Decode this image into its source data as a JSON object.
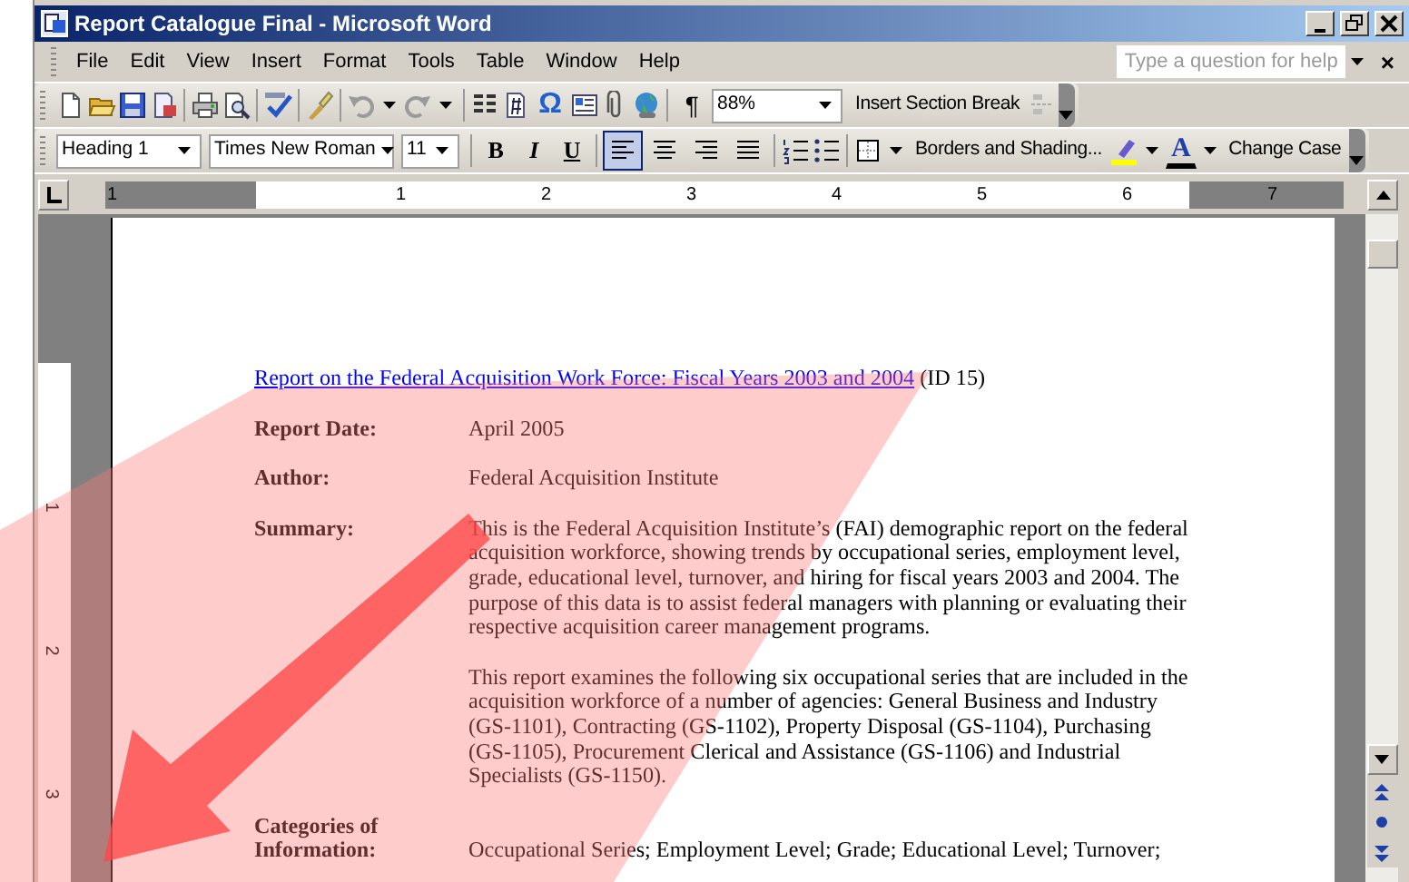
{
  "window": {
    "title": "Report Catalogue Final - Microsoft Word"
  },
  "menu": [
    "File",
    "Edit",
    "View",
    "Insert",
    "Format",
    "Tools",
    "Table",
    "Window",
    "Help"
  ],
  "help": {
    "placeholder": "Type a question for help",
    "close": "×"
  },
  "standard_toolbar": {
    "symbol": "Ω",
    "pilcrow": "¶",
    "zoom": "88%",
    "section_break": "Insert Section Break"
  },
  "formatting_toolbar": {
    "style": "Heading 1",
    "font": "Times New Roman",
    "size": "11",
    "bold": "B",
    "italic": "I",
    "underline": "U",
    "alignment_buttons": [
      {
        "selected": true
      },
      {
        "selected": false
      },
      {
        "selected": false
      },
      {
        "selected": false
      }
    ],
    "borders": "Borders and Shading...",
    "font_color": "A",
    "change_case": "Change Case"
  },
  "ruler": {
    "horizontal": [
      "1",
      "1",
      "2",
      "3",
      "4",
      "5",
      "6",
      "7"
    ],
    "vertical": [
      "1",
      "2",
      "3"
    ]
  },
  "document": {
    "title_link": "Report on the Federal Acquisition Work Force: Fiscal Years 2003 and 2004",
    "title_suffix": "(ID 15)",
    "fields": [
      {
        "label": "Report Date:",
        "paragraphs": [
          "April 2005"
        ]
      },
      {
        "label": "Author:",
        "paragraphs": [
          "Federal Acquisition Institute"
        ]
      },
      {
        "label": "Summary:",
        "paragraphs": [
          "This is the Federal Acquisition Institute’s (FAI) demographic report on the federal acquisition workforce, showing trends by occupational series, employment level, grade, educational level, turnover, and hiring for fiscal years 2003 and 2004. The purpose of this data is to assist federal managers with planning or evaluating their respective acquisition career management programs.",
          "This report examines the following six occupational series that are included in the acquisition workforce of a number of agencies: General Business and Industry (GS-1101), Contracting (GS-1102), Property Disposal (GS-1104), Purchasing (GS-1105), Procurement Clerical and Assistance (GS-1106) and Industrial Specialists (GS-1150)."
        ]
      },
      {
        "label": "Categories of Information:",
        "paragraphs": [
          "Occupational Series; Employment Level; Grade; Educational Level; Turnover;"
        ]
      }
    ]
  }
}
